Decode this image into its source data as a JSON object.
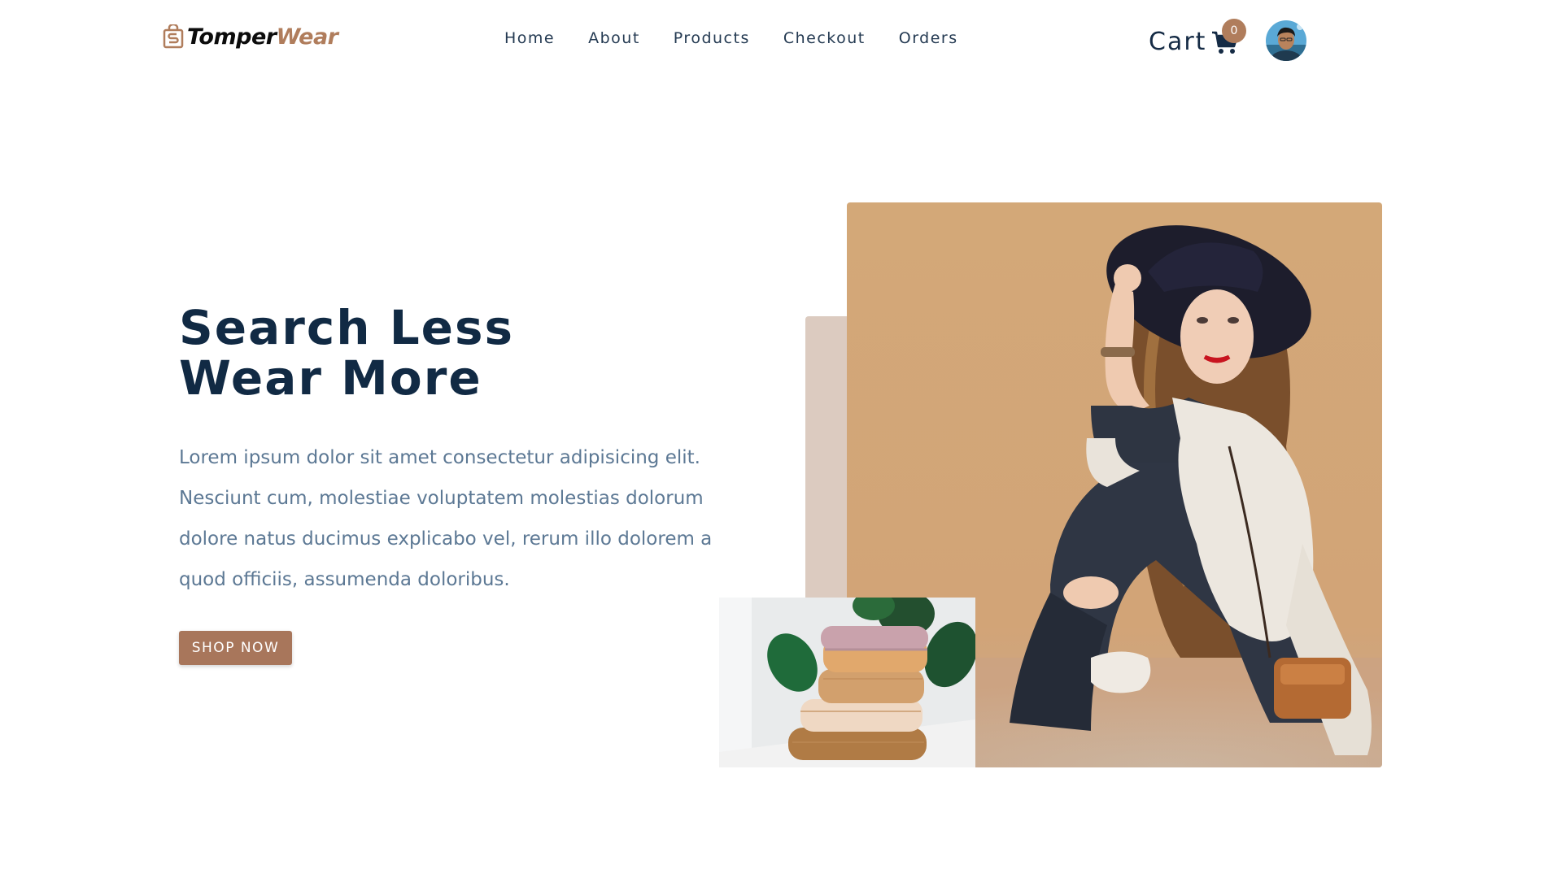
{
  "brand": {
    "name_part1": "Tomper",
    "name_part2": "Wear",
    "accent_color": "#b07d5c",
    "text_color": "#0c0c0c"
  },
  "nav": {
    "links": [
      {
        "label": "Home"
      },
      {
        "label": "About"
      },
      {
        "label": "Products"
      },
      {
        "label": "Checkout"
      },
      {
        "label": "Orders"
      }
    ]
  },
  "cart": {
    "label": "Cart",
    "count": "0",
    "icon": "shopping-cart-icon"
  },
  "user": {
    "avatar_icon": "user-avatar"
  },
  "hero": {
    "title_line1": "Search Less",
    "title_line2": "Wear More",
    "description": "Lorem ipsum dolor sit amet consectetur adipisicing elit. Nesciunt cum, molestiae voluptatem molestias dolorum dolore natus ducimus explicabo vel, rerum illo dolorem a quod officiis, assumenda doloribus.",
    "cta_label": "SHOP NOW",
    "main_image": "woman-in-hat-fashion-photo",
    "secondary_image": "folded-sweaters-photo"
  },
  "colors": {
    "heading": "#112a44",
    "body_text": "#5c7894",
    "button": "#a8765b",
    "accent_block": "#dccbc0",
    "photo_background": "#d4a97c"
  }
}
